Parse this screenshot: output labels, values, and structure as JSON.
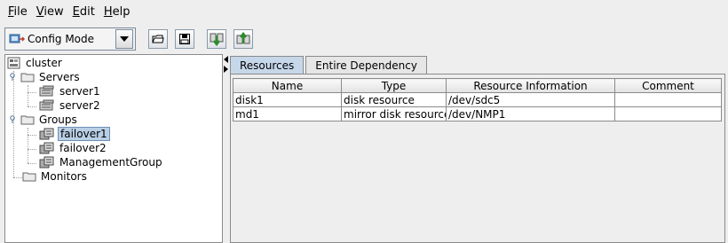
{
  "menu": [
    {
      "label": "File",
      "mnemonic": "F",
      "rest": "ile"
    },
    {
      "label": "View",
      "mnemonic": "V",
      "rest": "iew"
    },
    {
      "label": "Edit",
      "mnemonic": "E",
      "rest": "dit"
    },
    {
      "label": "Help",
      "mnemonic": "H",
      "rest": "elp"
    }
  ],
  "toolbar": {
    "mode": "Config Mode",
    "icons": [
      "open-folder-icon",
      "save-icon",
      "download-icon",
      "upload-icon"
    ]
  },
  "tree": {
    "root": "cluster",
    "servers": "Servers",
    "server1": "server1",
    "server2": "server2",
    "groups": "Groups",
    "failover1": "failover1",
    "failover2": "failover2",
    "management": "ManagementGroup",
    "monitors": "Monitors",
    "selected": "failover1"
  },
  "tabs": [
    "Resources",
    "Entire Dependency"
  ],
  "table": {
    "columns": [
      "Name",
      "Type",
      "Resource Information",
      "Comment"
    ],
    "rows": [
      [
        "disk1",
        "disk resource",
        "/dev/sdc5",
        ""
      ],
      [
        "md1",
        "mirror disk resource",
        "/dev/NMP1",
        ""
      ]
    ]
  },
  "colors": {
    "selection": "#b8cfe5",
    "active_tab": "#c6d7ea"
  }
}
